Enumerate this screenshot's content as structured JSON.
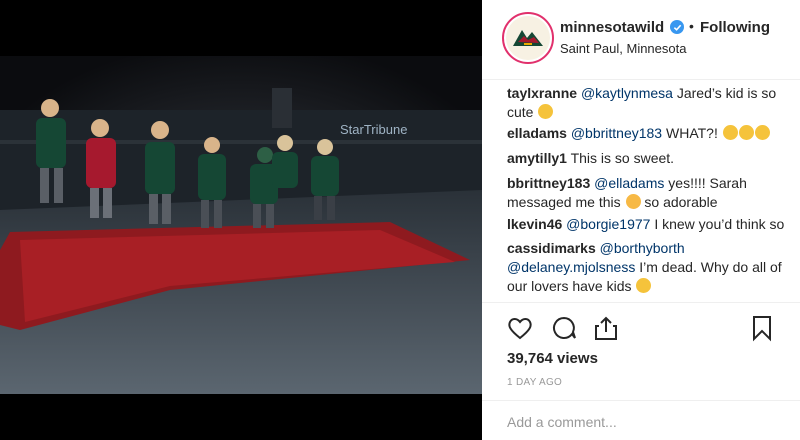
{
  "post": {
    "username": "minnesotawild",
    "follow_status": "Following",
    "location": "Saint Paul, Minnesota",
    "arena_sign": "StarTribune"
  },
  "comments": [
    {
      "user": "taylxranne",
      "mention": "@kaytlynmesa",
      "text": " Jared’s kid is so cute ",
      "emoji": "weary-face-emoji"
    },
    {
      "user": "elladams",
      "mention": "@bbrittney183",
      "text": " WHAT?! ",
      "emoji": "heart-eyes-and-crying-emoji"
    },
    {
      "user": "amytilly1",
      "mention": "",
      "text": " This is so sweet.",
      "emoji": ""
    },
    {
      "user": "bbrittney183",
      "mention": "@elladams",
      "text": " yes!!!! Sarah messaged me this ",
      "text2": " so adorable",
      "emoji": "blush-emoji"
    },
    {
      "user": "lkevin46",
      "mention": "@borgie1977",
      "text": " I knew you’d think so",
      "emoji": ""
    },
    {
      "user": "cassidimarks",
      "mention": "@borthyborth",
      "mention2": "@delaney.mjolsness",
      "text": " I’m dead. Why do all of our lovers have kids ",
      "emoji": "crying-emoji"
    }
  ],
  "stats": {
    "views": "39,764 views",
    "time_ago": "1 DAY AGO"
  },
  "composer": {
    "placeholder": "Add a comment..."
  },
  "colors": {
    "text": "#262626",
    "mention": "#003569",
    "muted": "#999999",
    "verified": "#3897f0",
    "wild_green": "#154734",
    "wild_red": "#a6192e"
  }
}
